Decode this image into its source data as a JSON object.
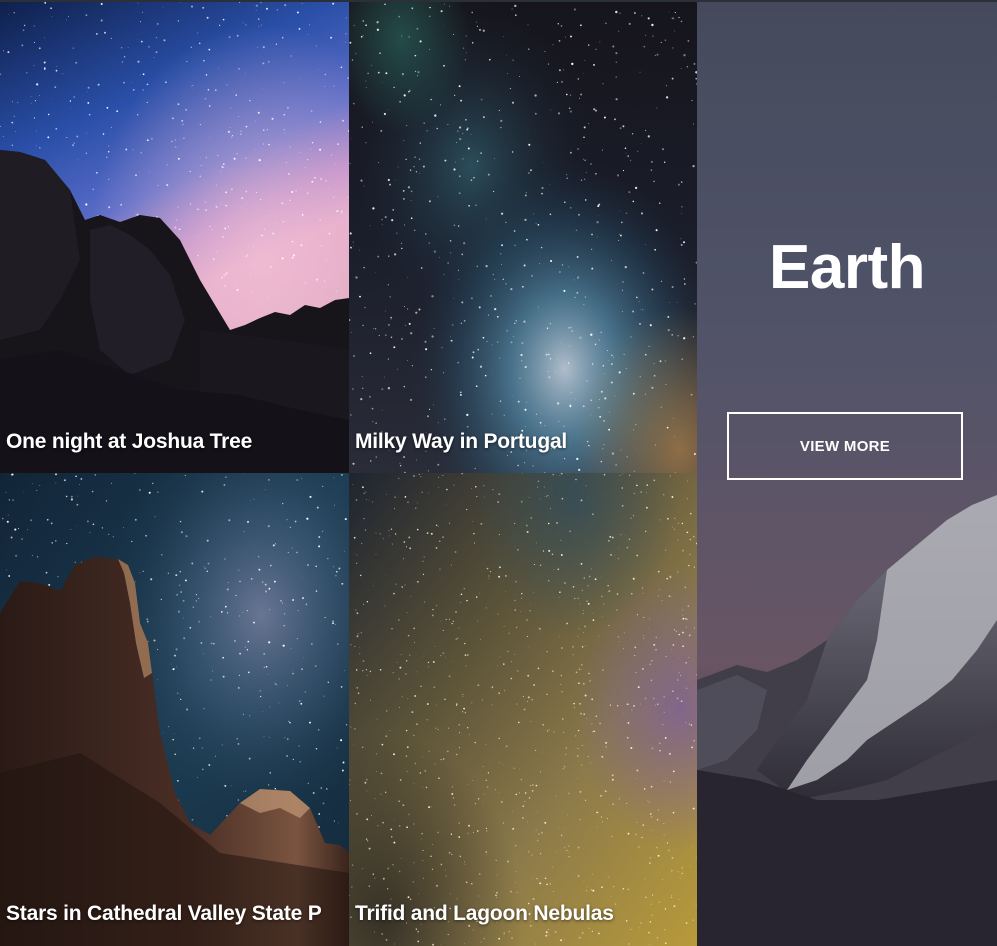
{
  "gallery": {
    "tiles": [
      {
        "title": "One night at Joshua Tree"
      },
      {
        "title": "Milky Way in Portugal"
      },
      {
        "title": "Stars in Cathedral Valley State P"
      },
      {
        "title": "Trifid and Lagoon Nebulas"
      }
    ]
  },
  "feature": {
    "title": "Earth",
    "button_label": "VIEW MORE"
  },
  "colors": {
    "text": "#ffffff",
    "night_sky": "#1b2a55",
    "dusk_pink": "#c08ab8",
    "feature_sky": "#5a6178"
  }
}
